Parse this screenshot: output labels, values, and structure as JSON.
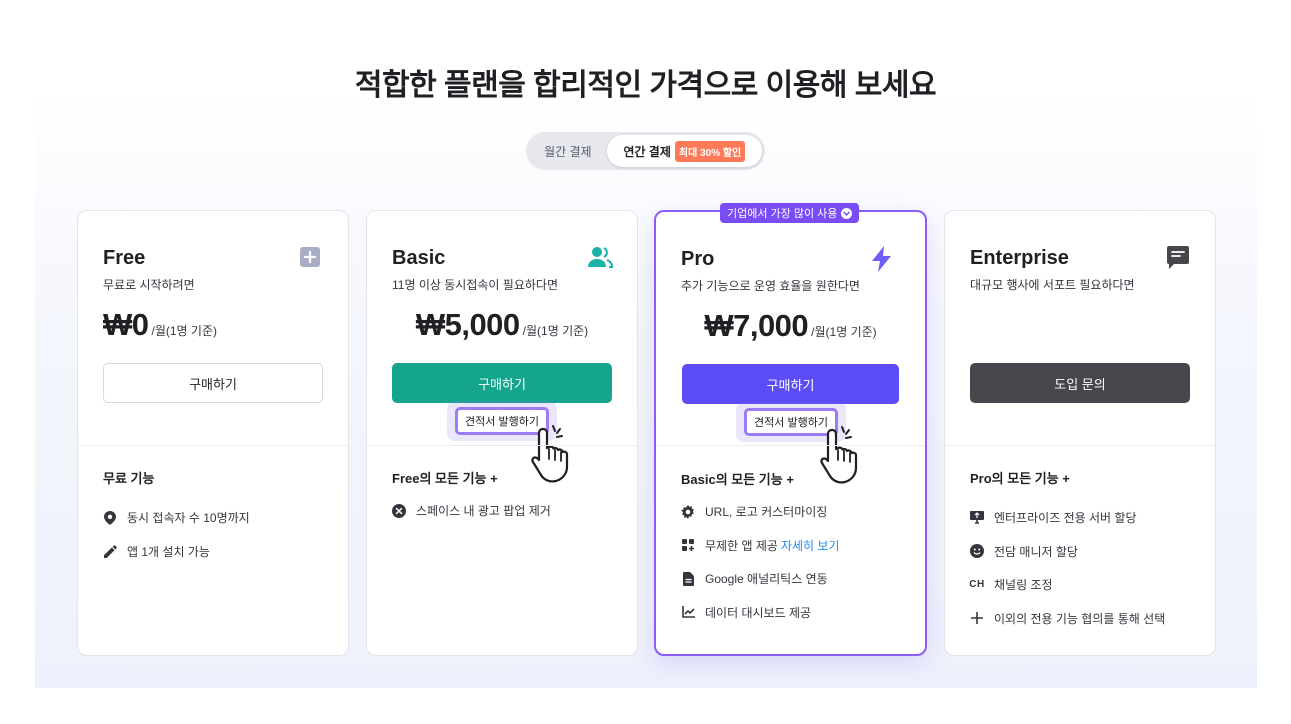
{
  "page_title": "적합한 플랜을 합리적인 가격으로 이용해 보세요",
  "billing": {
    "monthly_label": "월간 결제",
    "yearly_label": "연간 결제",
    "discount_badge": "최대 30% 할인",
    "selected": "yearly"
  },
  "colors": {
    "teal": "#14a58c",
    "violet": "#5b4cf5",
    "pro_border": "#8b5cf6",
    "dark": "#46464c",
    "discount": "#ff7a59",
    "link": "#1f8cf0"
  },
  "plans": [
    {
      "name": "Free",
      "description": "무료로 시작하려면",
      "price": "₩0",
      "price_unit": "/월(1명 기준)",
      "icon": "plus-square-icon",
      "cta_label": "구매하기",
      "features_title": "무료 기능",
      "features": [
        {
          "icon": "location-pin-icon",
          "text": "동시 접속자 수 10명까지"
        },
        {
          "icon": "pencil-icon",
          "text": "앱 1개 설치 가능"
        }
      ]
    },
    {
      "name": "Basic",
      "description": "11명 이상 동시접속이 필요하다면",
      "price": "₩5,000",
      "price_unit": "/월(1명 기준)",
      "icon": "users-icon",
      "cta_label": "구매하기",
      "quote_label": "견적서 발행하기",
      "features_title": "Free의 모든 기능 +",
      "features": [
        {
          "icon": "close-circle-icon",
          "text": "스페이스 내 광고 팝업 제거"
        }
      ]
    },
    {
      "name": "Pro",
      "badge": "기업에서 가장 많이 사용",
      "description": "추가 기능으로 운영 효율을 원한다면",
      "price": "₩7,000",
      "price_unit": "/월(1명 기준)",
      "icon": "lightning-icon",
      "cta_label": "구매하기",
      "quote_label": "견적서 발행하기",
      "features_title": "Basic의 모든 기능 +",
      "features": [
        {
          "icon": "gear-icon",
          "text": "URL, 로고 커스터마이징"
        },
        {
          "icon": "apps-add-icon",
          "text": "무제한 앱 제공",
          "link": "자세히 보기"
        },
        {
          "icon": "document-icon",
          "text": "Google 애널리틱스 연동"
        },
        {
          "icon": "chart-line-icon",
          "text": "데이터 대시보드 제공"
        }
      ]
    },
    {
      "name": "Enterprise",
      "description": "대규모 행사에 서포트 필요하다면",
      "icon": "chat-icon",
      "cta_label": "도입 문의",
      "features_title": "Pro의 모든 기능 +",
      "features": [
        {
          "icon": "server-monitor-icon",
          "text": "엔터프라이즈 전용 서버 할당"
        },
        {
          "icon": "smiley-icon",
          "text": "전담 매니저 할당"
        },
        {
          "icon": "ch-text-icon",
          "icon_text": "CH",
          "text": "채널링 조정"
        },
        {
          "icon": "plus-icon",
          "text": "이외의 전용 기능 협의를 통해 선택"
        }
      ]
    }
  ]
}
